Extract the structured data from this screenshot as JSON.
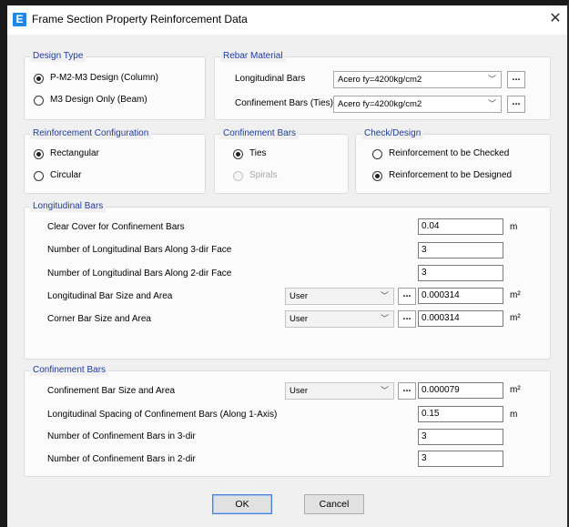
{
  "window": {
    "title": "Frame Section Property Reinforcement Data",
    "icon_letter": "E",
    "close_glyph": "✕",
    "accent": "#1e88e5"
  },
  "design_type": {
    "title": "Design Type",
    "options": [
      "P-M2-M3 Design  (Column)",
      "M3 Design Only  (Beam)"
    ],
    "selected": "P-M2-M3 Design  (Column)"
  },
  "rebar_material": {
    "title": "Rebar Material",
    "longitudinal_label": "Longitudinal Bars",
    "longitudinal_value": "Acero fy=4200kg/cm2",
    "confinement_label": "Confinement Bars (Ties)",
    "confinement_value": "Acero fy=4200kg/cm2",
    "button": "..."
  },
  "reinforcement_configuration": {
    "title": "Reinforcement Configuration",
    "options": [
      "Rectangular",
      "Circular"
    ],
    "selected": "Rectangular"
  },
  "confinement_type": {
    "title": "Confinement Bars",
    "options": [
      "Ties",
      "Spirals"
    ],
    "selected": "Ties"
  },
  "check_design": {
    "title": "Check/Design",
    "options": [
      "Reinforcement to be Checked",
      "Reinforcement to be Designed"
    ],
    "selected": "Reinforcement to be Designed"
  },
  "longitudinal_bars": {
    "title": "Longitudinal Bars",
    "clear_cover_label": "Clear Cover for Confinement Bars",
    "clear_cover_value": "0.04",
    "clear_cover_unit": "m",
    "num_3dir_label": "Number of Longitudinal Bars Along 3-dir Face",
    "num_3dir_value": "3",
    "num_2dir_label": "Number of Longitudinal Bars Along 2-dir Face",
    "num_2dir_value": "3",
    "bar_size_label": "Longitudinal Bar Size and Area",
    "bar_size_select": "User",
    "bar_size_value": "0.000314",
    "bar_size_unit": "m²",
    "corner_label": "Corner Bar Size and Area",
    "corner_select": "User",
    "corner_value": "0.000314",
    "corner_unit": "m²"
  },
  "confinement_bars": {
    "title": "Confinement Bars",
    "size_label": "Confinement Bar Size and Area",
    "size_select": "User",
    "size_value": "0.000079",
    "size_unit": "m²",
    "spacing_label": "Longitudinal Spacing of Confinement Bars  (Along 1-Axis)",
    "spacing_value": "0.15",
    "spacing_unit": "m",
    "num_3dir_label": "Number of Confinement Bars in 3-dir",
    "num_3dir_value": "3",
    "num_2dir_label": "Number of Confinement Bars in 2-dir",
    "num_2dir_value": "3"
  },
  "buttons": {
    "ok": "OK",
    "cancel": "Cancel"
  }
}
